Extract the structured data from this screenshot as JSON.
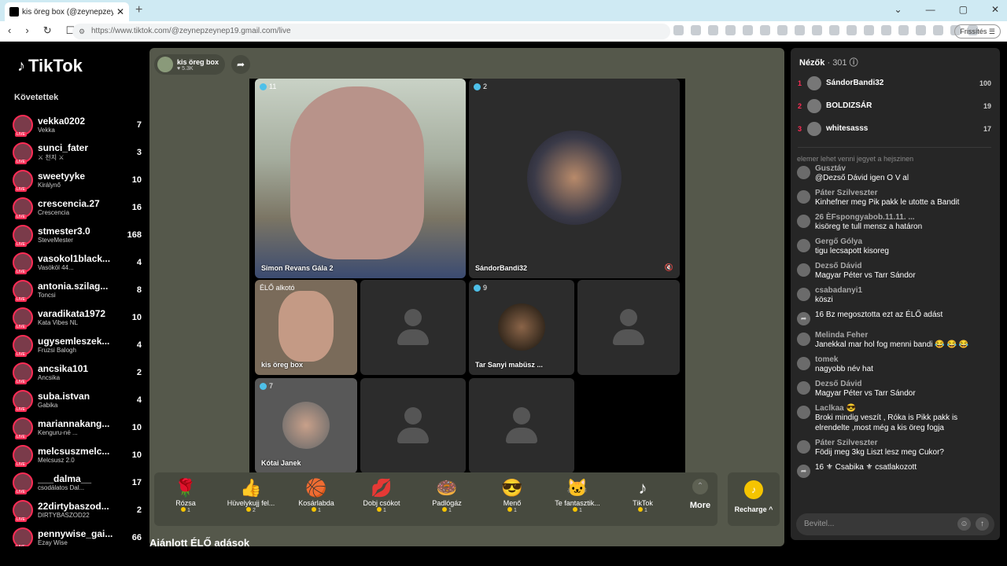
{
  "browser": {
    "tab_title": "kis öreg box (@zeynepzeyne...",
    "new_tab": "+",
    "url": "https://www.tiktok.com/@zeynepzeynep19.gmail.com/live",
    "update_label": "Frissítés"
  },
  "sidebar": {
    "logo": "TikTok",
    "following_title": "Követettek",
    "items": [
      {
        "name": "vekka0202",
        "sub": "Vekka",
        "count": "7"
      },
      {
        "name": "sunci_fater",
        "sub": "⚔ 천지 ⚔",
        "count": "3"
      },
      {
        "name": "sweetyyke",
        "sub": "Királynő",
        "count": "10"
      },
      {
        "name": "crescencia.27",
        "sub": "Crescencia",
        "count": "16"
      },
      {
        "name": "stmester3.0",
        "sub": "SteveMester",
        "count": "168"
      },
      {
        "name": "vasokol1black...",
        "sub": "Vasököl 44...",
        "count": "4"
      },
      {
        "name": "antonia.szilag...",
        "sub": "Toncsi",
        "count": "8"
      },
      {
        "name": "varadikata1972",
        "sub": "Kata Vibes NL",
        "count": "10"
      },
      {
        "name": "ugysemleszek...",
        "sub": "Fruzsi Balogh",
        "count": "4"
      },
      {
        "name": "ancsika101",
        "sub": "Ancsika",
        "count": "2"
      },
      {
        "name": "suba.istvan",
        "sub": "Gabika",
        "count": "4"
      },
      {
        "name": "mariannakang...",
        "sub": "Kenguru-né ...",
        "count": "10"
      },
      {
        "name": "melcsuszmelc...",
        "sub": "Melcsusz 2.0",
        "count": "10"
      },
      {
        "name": "___dalma__",
        "sub": "csodálatos Dal...",
        "count": "17"
      },
      {
        "name": "22dirtybaszod...",
        "sub": "DIRTYBASZOD22",
        "count": "2"
      },
      {
        "name": "pennywise_gai...",
        "sub": "Ezay Wise",
        "count": "66"
      }
    ]
  },
  "host": {
    "name": "kis öreg box",
    "likes": "♥ 5.3K"
  },
  "tiles": [
    {
      "badge": "11",
      "label": "Simon Revans Gála 2"
    },
    {
      "badge": "2",
      "label": "SándorBandi32"
    },
    {
      "badge": "",
      "label": "kis öreg box",
      "overlay": "ÉLŐ alkotó"
    },
    {
      "badge": "9",
      "label": "Tar Sanyi mabüsz ..."
    },
    {
      "badge": "7",
      "label": "Kótai Janek"
    }
  ],
  "gifts": [
    {
      "icon": "🌹",
      "name": "Rózsa",
      "price": "1"
    },
    {
      "icon": "👍",
      "name": "Hüvelykujj fel...",
      "price": "2"
    },
    {
      "icon": "🏀",
      "name": "Kosárlabda",
      "price": "1"
    },
    {
      "icon": "💋",
      "name": "Dobj csókot",
      "price": "1"
    },
    {
      "icon": "🍩",
      "name": "Padlógáz",
      "price": "1"
    },
    {
      "icon": "😎",
      "name": "Menő",
      "price": "1"
    },
    {
      "icon": "🐱",
      "name": "Te fantasztik...",
      "price": "1"
    },
    {
      "icon": "♪",
      "name": "TikTok",
      "price": "1"
    }
  ],
  "more_label": "More",
  "recharge_label": "Recharge ^",
  "recommended": "Ajánlott ÉLŐ adások",
  "viewers": {
    "title": "Nézők",
    "count": "· 301",
    "list": [
      {
        "rank": "1",
        "name": "SándorBandi32",
        "score": "100"
      },
      {
        "rank": "2",
        "name": "BOLDIZSÁR",
        "score": "19"
      },
      {
        "rank": "3",
        "name": "whitesasss",
        "score": "17"
      }
    ]
  },
  "chat_fade": "elemer lehet venni jegyet a hejszinen",
  "chat": [
    {
      "user": "Gusztáv",
      "text": "@Dezső Dávid igen O V al"
    },
    {
      "user": "Páter Szilveszter",
      "text": "Kinhefner meg Pik pakk le utotte a Bandit"
    },
    {
      "user": "26 ÈFspongyabob.11.11. ...",
      "text": "kisöreg te tull mensz a határon"
    },
    {
      "user": "Gergő Gólya",
      "text": "tigu lecsapott kisoreg"
    },
    {
      "user": "Dezső Dávid",
      "text": "Magyar Péter vs Tarr Sándor"
    },
    {
      "user": "csabadanyi1",
      "text": "köszi"
    },
    {
      "user": "",
      "text": "16 Bz  megosztotta ezt az ÉLŐ adást"
    },
    {
      "user": "Melinda Feher",
      "text": "Janekkal mar hol fog menni bandi 😂 😂 😂"
    },
    {
      "user": "tomek",
      "text": "nagyobb név hat"
    },
    {
      "user": "Dezső Dávid",
      "text": "Magyar Péter vs Tarr Sándor"
    },
    {
      "user": "Laclkaa 😎",
      "text": "Broki mindig veszít , Róka is Pikk pakk is elrendelte ,most még a kis öreg fogja"
    },
    {
      "user": "Páter Szilveszter",
      "text": "Födij meg 3kg Liszt lesz meg Cukor?"
    },
    {
      "user": "",
      "text": "16 ⚜ Csabika ⚜ csatlakozott"
    }
  ],
  "input": {
    "placeholder": "Bevitel..."
  }
}
